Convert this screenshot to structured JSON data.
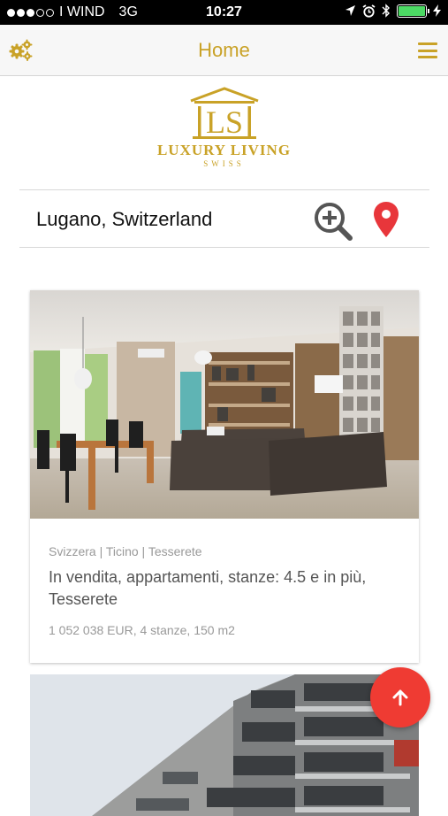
{
  "status_bar": {
    "carrier": "I WIND",
    "network": "3G",
    "time": "10:27",
    "signal_bars_filled": 3,
    "signal_bars_total": 5,
    "battery_color": "#4cd964"
  },
  "header": {
    "title": "Home",
    "left_icon": "gears-icon",
    "right_icon": "hamburger-menu-icon",
    "accent_color": "#c9a227"
  },
  "logo": {
    "monogram": "LS",
    "name": "LUXURY LIVING",
    "sub": "SWISS"
  },
  "search": {
    "value": "Lugano, Switzerland",
    "zoom_icon": "zoom-in-icon",
    "location_icon": "map-pin-icon",
    "pin_color": "#e8363b"
  },
  "listings": [
    {
      "location": "Svizzera | Ticino | Tesserete",
      "title": "In vendita, appartamenti, stanze: 4.5 e in più, Tesserete",
      "meta": "1 052 038 EUR, 4 stanze, 150 m2",
      "image": "living-room-photo"
    },
    {
      "image": "apartment-building-photo"
    }
  ],
  "fab": {
    "icon": "arrow-up-icon",
    "color": "#ef3b33"
  }
}
